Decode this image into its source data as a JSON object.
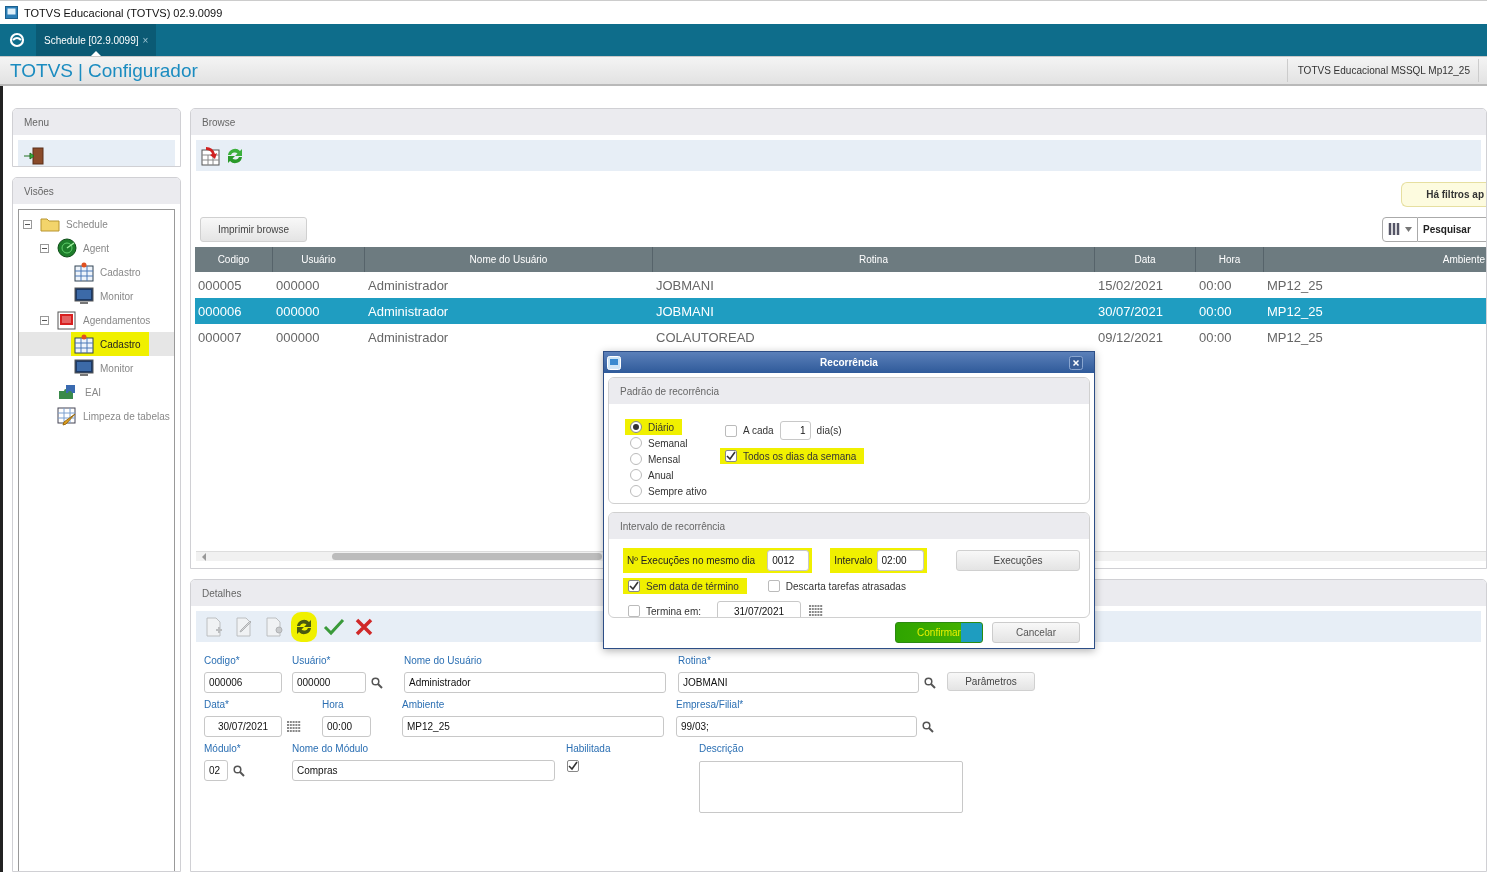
{
  "window": {
    "title": "TOTVS Educacional (TOTVS) 02.9.0099"
  },
  "tabs": [
    {
      "label": "Schedule [02.9.0099]",
      "close": "×",
      "selected": true
    }
  ],
  "header": {
    "brand": "TOTVS",
    "separator": "|",
    "app": "Configurador",
    "environment": "TOTVS Educacional MSSQL Mp12_25"
  },
  "menu": {
    "title": "Menu"
  },
  "views": {
    "title": "Visões",
    "tree": [
      {
        "label": "Schedule",
        "kind": "folder",
        "expanded": true,
        "selected": false,
        "highlighted": false,
        "children": [
          {
            "label": "Agent",
            "kind": "radar",
            "expanded": true,
            "selected": false,
            "highlighted": false,
            "children": [
              {
                "label": "Cadastro",
                "kind": "form",
                "selected": false,
                "highlighted": false
              },
              {
                "label": "Monitor",
                "kind": "monitor",
                "selected": false,
                "highlighted": false
              }
            ]
          },
          {
            "label": "Agendamentos",
            "kind": "calendar",
            "expanded": true,
            "selected": false,
            "highlighted": false,
            "children": [
              {
                "label": "Cadastro",
                "kind": "form",
                "selected": true,
                "highlighted": true
              },
              {
                "label": "Monitor",
                "kind": "monitor",
                "selected": false,
                "highlighted": false
              }
            ]
          },
          {
            "label": "EAI",
            "kind": "puzzle",
            "selected": false,
            "highlighted": false
          },
          {
            "label": "Limpeza de tabelas",
            "kind": "table",
            "selected": false,
            "highlighted": false
          }
        ]
      }
    ]
  },
  "browse": {
    "title": "Browse",
    "filter_notice": "Há filtros ap",
    "print_button": "Imprimir browse",
    "search": {
      "placeholder": "Pesquisar"
    },
    "table": {
      "columns": [
        {
          "label": "Codigo"
        },
        {
          "label": "Usuário"
        },
        {
          "label": "Nome do Usuário"
        },
        {
          "label": "Rotina"
        },
        {
          "label": "Data"
        },
        {
          "label": "Hora"
        },
        {
          "label": "Ambiente"
        }
      ],
      "rows": [
        {
          "cells": [
            "000005",
            "000000",
            "Administrador",
            "JOBMANI",
            "15/02/2021",
            "00:00",
            "MP12_25"
          ],
          "selected": false
        },
        {
          "cells": [
            "000006",
            "000000",
            "Administrador",
            "JOBMANI",
            "30/07/2021",
            "00:00",
            "MP12_25"
          ],
          "selected": true
        },
        {
          "cells": [
            "000007",
            "000000",
            "Administrador",
            "COLAUTOREAD",
            "09/12/2021",
            "00:00",
            "MP12_25"
          ],
          "selected": false
        }
      ]
    }
  },
  "details": {
    "title": "Detalhes",
    "toolbar": [
      {
        "kind": "add",
        "disabled": true,
        "highlighted": false
      },
      {
        "kind": "edit",
        "disabled": true,
        "highlighted": false
      },
      {
        "kind": "config",
        "disabled": true,
        "highlighted": false
      },
      {
        "kind": "refresh",
        "disabled": false,
        "highlighted": true
      },
      {
        "kind": "confirm",
        "disabled": false,
        "highlighted": false
      },
      {
        "kind": "cancel",
        "disabled": false,
        "highlighted": false
      }
    ],
    "codigo": {
      "label": "Codigo*",
      "value": "000006"
    },
    "usuario": {
      "label": "Usuário*",
      "value": "000000"
    },
    "nome_usuario": {
      "label": "Nome do Usuário",
      "value": "Administrador"
    },
    "rotina": {
      "label": "Rotina*",
      "value": "JOBMANI"
    },
    "parametros_button": "Parâmetros",
    "data": {
      "label": "Data*",
      "value": "30/07/2021"
    },
    "hora": {
      "label": "Hora",
      "value": "00:00"
    },
    "ambiente": {
      "label": "Ambiente",
      "value": "MP12_25"
    },
    "empresa": {
      "label": "Empresa/Filial*",
      "value": "99/03;"
    },
    "modulo": {
      "label": "Módulo*",
      "value": "02"
    },
    "nome_modulo": {
      "label": "Nome do Módulo",
      "value": "Compras"
    },
    "habilitada": {
      "label": "Habilitada",
      "checked": true
    },
    "descricao": {
      "label": "Descrição"
    }
  },
  "dialog": {
    "title": "Recorrência",
    "pattern": {
      "title": "Padrão de recorrência",
      "options": [
        {
          "label": "Diário",
          "selected": true,
          "highlighted": true
        },
        {
          "label": "Semanal",
          "selected": false,
          "highlighted": false
        },
        {
          "label": "Mensal",
          "selected": false,
          "highlighted": false
        },
        {
          "label": "Anual",
          "selected": false,
          "highlighted": false
        },
        {
          "label": "Sempre ativo",
          "selected": false,
          "highlighted": false
        }
      ],
      "every": {
        "label": "A cada",
        "checked": false,
        "value": "1",
        "unit": "dia(s)"
      },
      "all_weekdays": {
        "label": "Todos os dias da semana",
        "checked": true,
        "highlighted": true
      }
    },
    "interval": {
      "title": "Intervalo de recorrência",
      "runs": {
        "label": "Nº Execuções no mesmo dia",
        "value": "0012",
        "highlighted": true
      },
      "interval": {
        "label": "Intervalo",
        "value": "02:00",
        "highlighted": true
      },
      "executions_button": "Execuções",
      "no_end": {
        "label": "Sem data de término",
        "checked": true,
        "highlighted": true
      },
      "discard": {
        "label": "Descarta tarefas atrasadas",
        "checked": false
      },
      "ends": {
        "label": "Termina em:",
        "checked": false,
        "value": "31/07/2021"
      }
    },
    "buttons": [
      {
        "label": "Confirmar",
        "kind": "primary",
        "highlighted": true
      },
      {
        "label": "Cancelar",
        "kind": "secondary"
      }
    ]
  }
}
